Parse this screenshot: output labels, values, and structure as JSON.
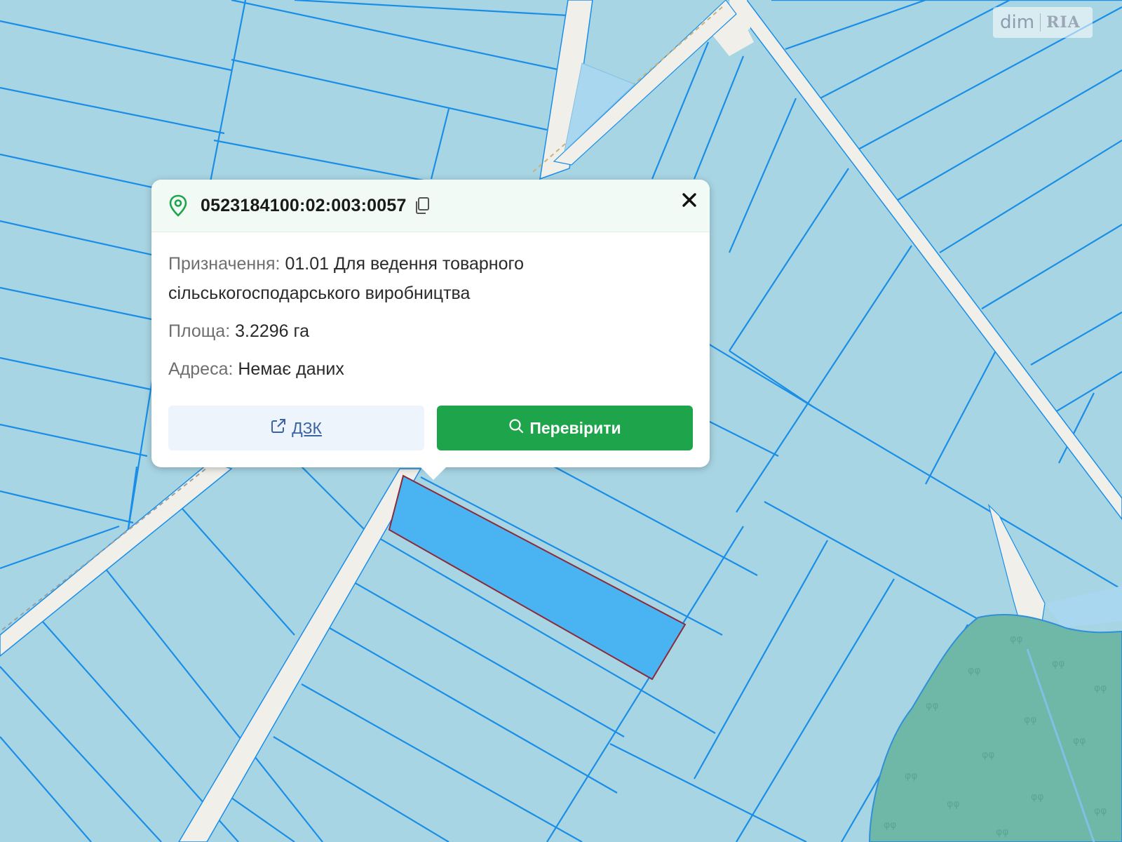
{
  "watermark": {
    "left": "dim",
    "right": "RIA"
  },
  "popup": {
    "cadastral_number": "0523184100:02:003:0057",
    "rows": [
      {
        "label": "Призначення:",
        "value": "01.01 Для ведення товарного",
        "value_line2": "сільськогосподарського виробництва"
      },
      {
        "label": "Площа:",
        "value": "3.2296 га"
      },
      {
        "label": "Адреса:",
        "value": "Немає даних"
      }
    ],
    "buttons": {
      "dzk": "ДЗК",
      "check": "Перевірити"
    }
  },
  "colors": {
    "parcel": "#a8d5e3",
    "parcel_border": "#1a8ee6",
    "road": "#f1efe9",
    "selected": "#4ab4f2",
    "selected_border": "#8a2a3a",
    "forest": "#6fb8a8",
    "accent_green": "#1ea44a"
  },
  "icons": [
    "location-pin-icon",
    "copy-icon",
    "close-icon",
    "external-link-icon",
    "search-icon"
  ]
}
